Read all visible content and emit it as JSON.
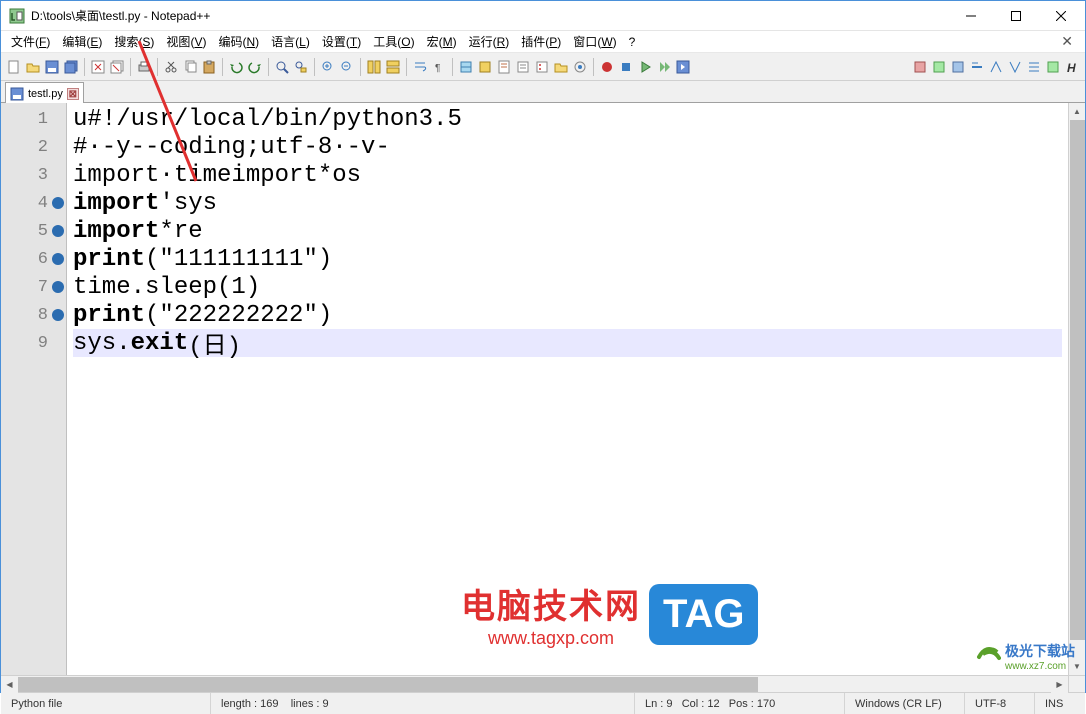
{
  "window": {
    "title": "D:\\tools\\桌面\\testl.py - Notepad++"
  },
  "menu": {
    "items": [
      {
        "label": "文件",
        "key": "F"
      },
      {
        "label": "编辑",
        "key": "E"
      },
      {
        "label": "搜索",
        "key": "S"
      },
      {
        "label": "视图",
        "key": "V"
      },
      {
        "label": "编码",
        "key": "N"
      },
      {
        "label": "语言",
        "key": "L"
      },
      {
        "label": "设置",
        "key": "T"
      },
      {
        "label": "工具",
        "key": "O"
      },
      {
        "label": "宏",
        "key": "M"
      },
      {
        "label": "运行",
        "key": "R"
      },
      {
        "label": "插件",
        "key": "P"
      },
      {
        "label": "窗口",
        "key": "W"
      },
      {
        "label": "?",
        "key": ""
      }
    ]
  },
  "tabs": [
    {
      "label": "testl.py"
    }
  ],
  "code": {
    "lines": [
      {
        "n": "1",
        "marker": false,
        "text": "u#!/usr/local/bin/python3.5"
      },
      {
        "n": "2",
        "marker": false,
        "text": "#·-y--coding;utf-8·-v-"
      },
      {
        "n": "3",
        "marker": false,
        "text": "import·timeimport*os"
      },
      {
        "n": "4",
        "marker": true,
        "segments": [
          {
            "t": "import",
            "b": true
          },
          {
            "t": "'sys",
            "b": false
          }
        ]
      },
      {
        "n": "5",
        "marker": true,
        "segments": [
          {
            "t": "import",
            "b": true
          },
          {
            "t": "*re",
            "b": false
          }
        ]
      },
      {
        "n": "6",
        "marker": true,
        "segments": [
          {
            "t": "print",
            "b": true
          },
          {
            "t": "(\"111111111\")",
            "b": false
          }
        ]
      },
      {
        "n": "7",
        "marker": true,
        "text": "time.sleep(1)"
      },
      {
        "n": "8",
        "marker": true,
        "segments": [
          {
            "t": "print",
            "b": true
          },
          {
            "t": "(\"222222222\")",
            "b": false
          }
        ]
      },
      {
        "n": "9",
        "marker": false,
        "current": true,
        "segments": [
          {
            "t": "sys.",
            "b": false
          },
          {
            "t": "exit",
            "b": true
          },
          {
            "t": "(日)",
            "b": false
          }
        ]
      }
    ]
  },
  "status": {
    "filetype": "Python file",
    "length": "length : 169",
    "lines": "lines : 9",
    "ln": "Ln : 9",
    "col": "Col : 12",
    "pos": "Pos : 170",
    "eol": "Windows (CR LF)",
    "encoding": "UTF-8",
    "mode": "INS"
  },
  "watermark": {
    "main": "电脑技术网",
    "url": "www.tagxp.com",
    "tag": "TAG",
    "wm2": "极光下载站",
    "wm2url": "www.xz7.com"
  }
}
